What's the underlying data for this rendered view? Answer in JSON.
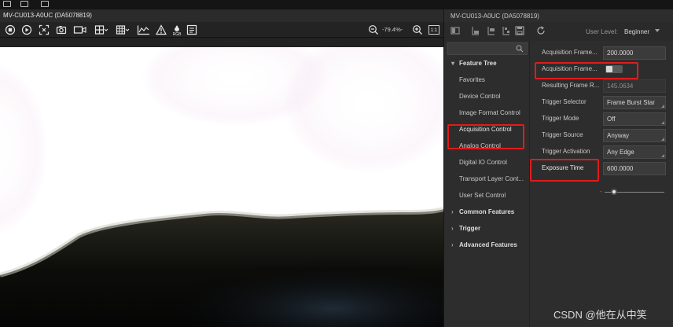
{
  "top_strip": {
    "icons": [
      "app-icon",
      "layout-icon",
      "window-icon"
    ]
  },
  "viewer": {
    "title": "MV-CU013-A0UC (DA5078819)",
    "toolbar_icons": [
      "stop-icon",
      "play-icon",
      "fit-icon",
      "snapshot-icon",
      "record-icon",
      "split-view-icon",
      "grid-view-icon",
      "histogram-icon",
      "warning-icon",
      "rgb-icon",
      "export-icon",
      "zoom-out-icon",
      "zoom-in-icon",
      "actual-size-icon"
    ],
    "zoom_level": "-79.4%-",
    "rgb_label": "RGB",
    "actual_size_label": "1:1"
  },
  "panel": {
    "title": "MV-CU013-A0UC (DA5078819)",
    "tool_icons": [
      "panel-icon",
      "import-icon",
      "export-icon",
      "compare-icon",
      "save-icon",
      "refresh-icon"
    ],
    "user_level_label": "User Level:",
    "user_level_value": "Beginner",
    "search": {
      "placeholder": ""
    }
  },
  "tree": [
    {
      "label": "Feature Tree",
      "kind": "category",
      "expanded": true
    },
    {
      "label": "Favorites",
      "kind": "item"
    },
    {
      "label": "Device Control",
      "kind": "item"
    },
    {
      "label": "Image Format Control",
      "kind": "item"
    },
    {
      "label": "Acquisition Control",
      "kind": "item",
      "selected": true
    },
    {
      "label": "Analog Control",
      "kind": "item"
    },
    {
      "label": "Digital IO Control",
      "kind": "item"
    },
    {
      "label": "Transport Layer Cont...",
      "kind": "item"
    },
    {
      "label": "User Set Control",
      "kind": "item"
    },
    {
      "label": "Common Features",
      "kind": "category",
      "expanded": false
    },
    {
      "label": "Trigger",
      "kind": "category",
      "expanded": false
    },
    {
      "label": "Advanced Features",
      "kind": "category",
      "expanded": false
    }
  ],
  "properties": [
    {
      "name": "Acquisition Frame...",
      "value": "200.0000",
      "type": "number"
    },
    {
      "name": "Acquisition Frame...",
      "value": "",
      "type": "toggle",
      "on": false
    },
    {
      "name": "Resulting Frame R...",
      "value": "145.0634",
      "type": "readonly"
    },
    {
      "name": "Trigger Selector",
      "value": "Frame Burst Star",
      "type": "select"
    },
    {
      "name": "Trigger Mode",
      "value": "Off",
      "type": "select"
    },
    {
      "name": "Trigger Source",
      "value": "Anyway",
      "type": "select"
    },
    {
      "name": "Trigger Activation",
      "value": "Any Edge",
      "type": "select"
    },
    {
      "name": "Exposure Time",
      "value": "600.0000",
      "type": "number"
    }
  ],
  "exposure_slider": {
    "fraction": 0.12
  },
  "colors": {
    "highlight": "#e11b1b",
    "panel_bg": "#2d2d2d",
    "toolbar_bg": "#232323"
  },
  "watermark": "CSDN @他在从中笑"
}
